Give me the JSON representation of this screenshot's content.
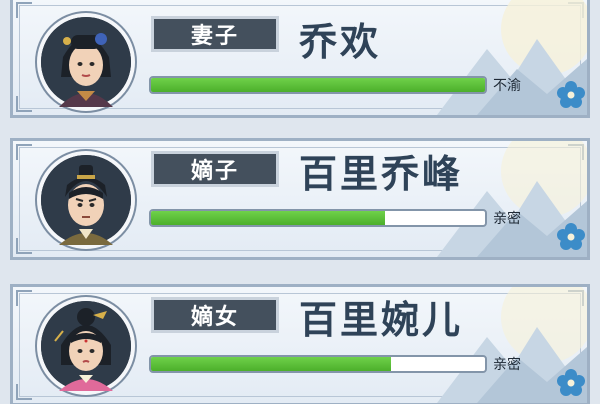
{
  "members": [
    {
      "relation": "妻子",
      "name": "乔欢",
      "affection_status": "不渝",
      "affection_level": 1.0,
      "avatar_icon": "wife-portrait-icon",
      "bar_color": "#5cc23a"
    },
    {
      "relation": "嫡子",
      "name": "百里乔峰",
      "affection_status": "亲密",
      "affection_level": 0.7,
      "avatar_icon": "son-portrait-icon",
      "bar_color": "#5cc23a"
    },
    {
      "relation": "嫡女",
      "name": "百里婉儿",
      "affection_status": "亲密",
      "affection_level": 0.72,
      "avatar_icon": "daughter-portrait-icon",
      "bar_color": "#5cc23a"
    }
  ],
  "colors": {
    "frame": "#9eb0c4",
    "plate": "#44505d",
    "name_text": "#2f4358"
  }
}
